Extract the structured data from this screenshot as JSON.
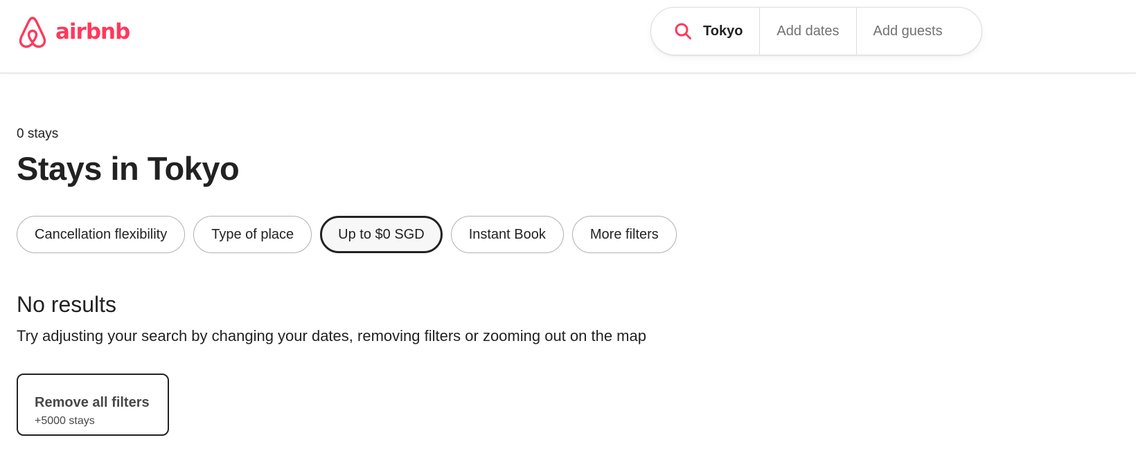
{
  "brand": {
    "name": "airbnb",
    "color": "#FF385C",
    "logo_icon": "airbnb-belo-icon"
  },
  "search": {
    "location": "Tokyo",
    "dates_placeholder": "Add dates",
    "guests_placeholder": "Add guests",
    "icon": "search-icon"
  },
  "results": {
    "count_label": "0 stays",
    "title": "Stays in Tokyo"
  },
  "filters": [
    {
      "label": "Cancellation flexibility",
      "active": false
    },
    {
      "label": "Type of place",
      "active": false
    },
    {
      "label": "Up to $0 SGD",
      "active": true
    },
    {
      "label": "Instant Book",
      "active": false
    },
    {
      "label": "More filters",
      "active": false
    }
  ],
  "empty_state": {
    "heading": "No results",
    "message": "Try adjusting your search by changing your dates, removing filters or zooming out on the map"
  },
  "remove_filters": {
    "label": "Remove all filters",
    "sublabel": "+5000 stays"
  }
}
